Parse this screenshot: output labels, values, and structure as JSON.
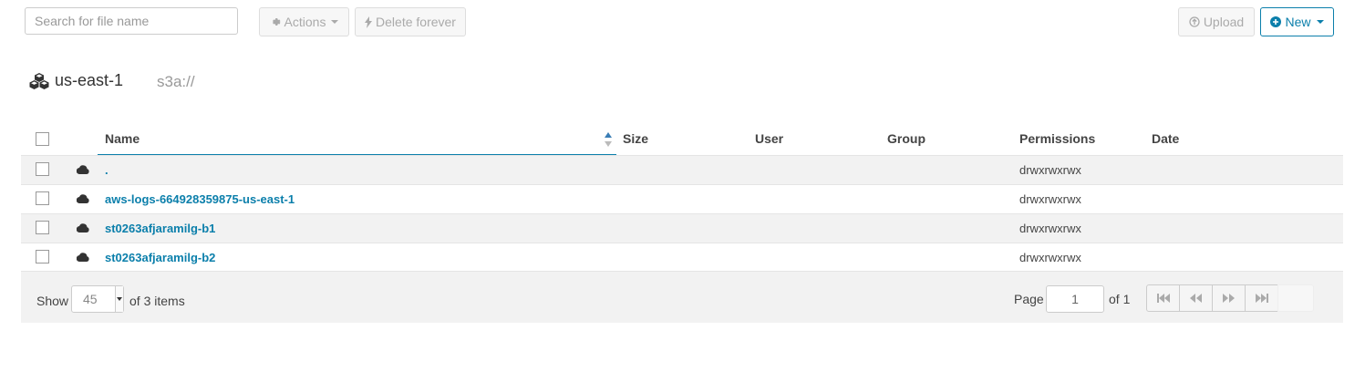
{
  "toolbar": {
    "search_placeholder": "Search for file name",
    "actions_label": "Actions",
    "delete_label": "Delete forever",
    "upload_label": "Upload",
    "new_label": "New"
  },
  "breadcrumb": {
    "bucket": "us-east-1",
    "path": "s3a://"
  },
  "table": {
    "columns": [
      "Name",
      "Size",
      "User",
      "Group",
      "Permissions",
      "Date"
    ],
    "rows": [
      {
        "name": ".",
        "permissions": "drwxrwxrwx"
      },
      {
        "name": "aws-logs-664928359875-us-east-1",
        "permissions": "drwxrwxrwx"
      },
      {
        "name": "st0263afjaramilg-b1",
        "permissions": "drwxrwxrwx"
      },
      {
        "name": "st0263afjaramilg-b2",
        "permissions": "drwxrwxrwx"
      }
    ]
  },
  "footer": {
    "show_label": "Show",
    "page_size": "45",
    "items_text": "of 3 items",
    "page_label": "Page",
    "page_value": "1",
    "of_pages": "of 1"
  },
  "colors": {
    "accent": "#0b7fab",
    "row_alt": "#f2f2f2"
  }
}
